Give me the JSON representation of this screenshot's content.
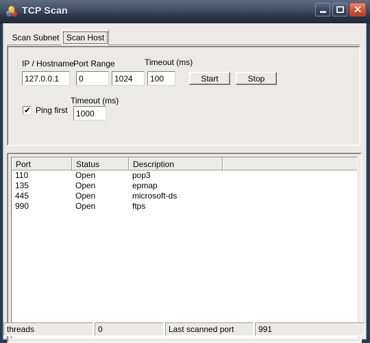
{
  "window": {
    "title": "TCP Scan",
    "icon": "balloons-icon",
    "controls": {
      "minimize_label": "Minimize",
      "maximize_label": "Maximize",
      "close_label": "Close"
    },
    "colors": {
      "titlebar_top": "#5d6b82",
      "titlebar_bottom": "#232c40",
      "frame": "#2b3a54",
      "face": "#eceae6",
      "close_button": "#e05a38"
    }
  },
  "tabs": [
    {
      "label": "Scan Subnet",
      "active": false
    },
    {
      "label": "Scan Host",
      "active": true
    }
  ],
  "form": {
    "ip_label": "IP / Hostname",
    "ip_value": "127.0.0.1",
    "port_range_label": "Port Range",
    "port_from_value": "0",
    "port_to_value": "1024",
    "timeout_label": "Timeout (ms)",
    "timeout_value": "100",
    "start_label": "Start",
    "stop_label": "Stop",
    "ping_label": "Ping first",
    "ping_checked": true,
    "ping_check_glyph": "✔",
    "ping_timeout_label": "Timeout (ms)",
    "ping_timeout_value": "1000"
  },
  "results": {
    "columns": [
      "Port",
      "Status",
      "Description",
      ""
    ],
    "rows": [
      {
        "port": "110",
        "status": "Open",
        "description": "pop3"
      },
      {
        "port": "135",
        "status": "Open",
        "description": "epmap"
      },
      {
        "port": "445",
        "status": "Open",
        "description": "microsoft-ds"
      },
      {
        "port": "990",
        "status": "Open",
        "description": "ftps"
      }
    ]
  },
  "statusbar": {
    "threads_label": "threads",
    "threads_value": "0",
    "last_port_label": "Last scanned port",
    "last_port_value": "991"
  }
}
